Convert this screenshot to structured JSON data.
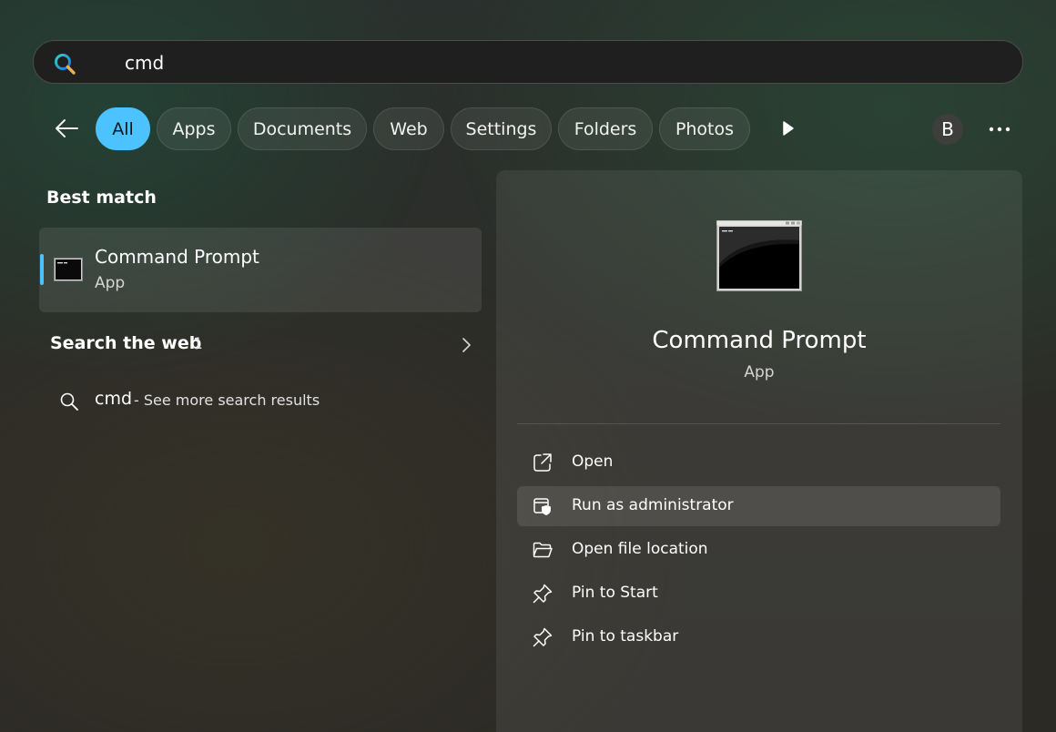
{
  "search": {
    "query": "cmd"
  },
  "filters": {
    "back_label": "",
    "chips": [
      "All",
      "Apps",
      "Documents",
      "Web",
      "Settings",
      "Folders",
      "Photos"
    ],
    "active": "All",
    "avatar_letter": "B"
  },
  "best_match": {
    "heading": "Best match",
    "title": "Command Prompt",
    "subtitle": "App"
  },
  "web": {
    "heading": "Search the web",
    "count": "1",
    "query": "cmd",
    "suffix": "- See more search results"
  },
  "detail": {
    "title": "Command Prompt",
    "subtitle": "App",
    "actions": [
      {
        "label": "Open",
        "icon": "open-external-icon"
      },
      {
        "label": "Run as administrator",
        "icon": "admin-shield-icon"
      },
      {
        "label": "Open file location",
        "icon": "folder-open-icon"
      },
      {
        "label": "Pin to Start",
        "icon": "pin-icon"
      },
      {
        "label": "Pin to taskbar",
        "icon": "pin-icon"
      }
    ]
  },
  "colors": {
    "accent": "#4cc2ff"
  }
}
